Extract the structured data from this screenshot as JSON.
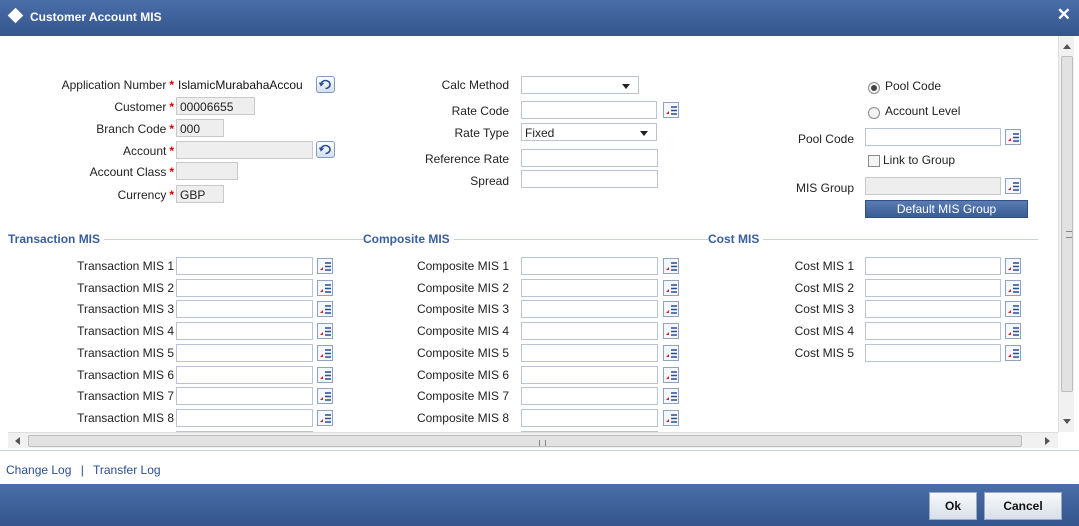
{
  "window": {
    "title": "Customer Account MIS",
    "close": "✕"
  },
  "header_fields": {
    "application_number": {
      "label": "Application Number",
      "value": "IslamicMurabahaAccou"
    },
    "customer": {
      "label": "Customer",
      "value": "00006655"
    },
    "branch_code": {
      "label": "Branch Code",
      "value": "000"
    },
    "account": {
      "label": "Account",
      "value": ""
    },
    "account_class": {
      "label": "Account Class",
      "value": ""
    },
    "currency": {
      "label": "Currency",
      "value": "GBP"
    },
    "required_mark": "*"
  },
  "rate_fields": {
    "calc_method": {
      "label": "Calc Method",
      "value": ""
    },
    "rate_code": {
      "label": "Rate Code",
      "value": ""
    },
    "rate_type": {
      "label": "Rate Type",
      "value": "Fixed"
    },
    "reference_rate": {
      "label": "Reference Rate",
      "value": ""
    },
    "spread": {
      "label": "Spread",
      "value": ""
    }
  },
  "pool_options": {
    "pool_code_radio": {
      "label": "Pool Code",
      "selected": true
    },
    "account_level_radio": {
      "label": "Account Level",
      "selected": false
    },
    "pool_code": {
      "label": "Pool Code",
      "value": ""
    },
    "link_to_group": {
      "label": "Link to Group",
      "checked": false
    },
    "mis_group": {
      "label": "MIS Group",
      "value": ""
    },
    "default_mis_group_button": "Default MIS Group"
  },
  "sections": {
    "transaction": {
      "title": "Transaction MIS",
      "items": [
        "Transaction MIS 1",
        "Transaction MIS 2",
        "Transaction MIS 3",
        "Transaction MIS 4",
        "Transaction MIS 5",
        "Transaction MIS 6",
        "Transaction MIS 7",
        "Transaction MIS 8"
      ]
    },
    "composite": {
      "title": "Composite MIS",
      "items": [
        "Composite MIS 1",
        "Composite MIS 2",
        "Composite MIS 3",
        "Composite MIS 4",
        "Composite MIS 5",
        "Composite MIS 6",
        "Composite MIS 7",
        "Composite MIS 8"
      ]
    },
    "cost": {
      "title": "Cost MIS",
      "items": [
        "Cost MIS 1",
        "Cost MIS 2",
        "Cost MIS 3",
        "Cost MIS 4",
        "Cost MIS 5"
      ]
    }
  },
  "footer": {
    "change_log": "Change Log",
    "separator": "|",
    "transfer_log": "Transfer Log",
    "ok": "Ok",
    "cancel": "Cancel"
  },
  "colors": {
    "title_bar": "#3d5f99",
    "section_title": "#3a5da0",
    "required": "#dd0000"
  },
  "icons": {
    "lov": "list-of-values-icon",
    "refresh": "refresh-icon",
    "close": "close-icon"
  }
}
